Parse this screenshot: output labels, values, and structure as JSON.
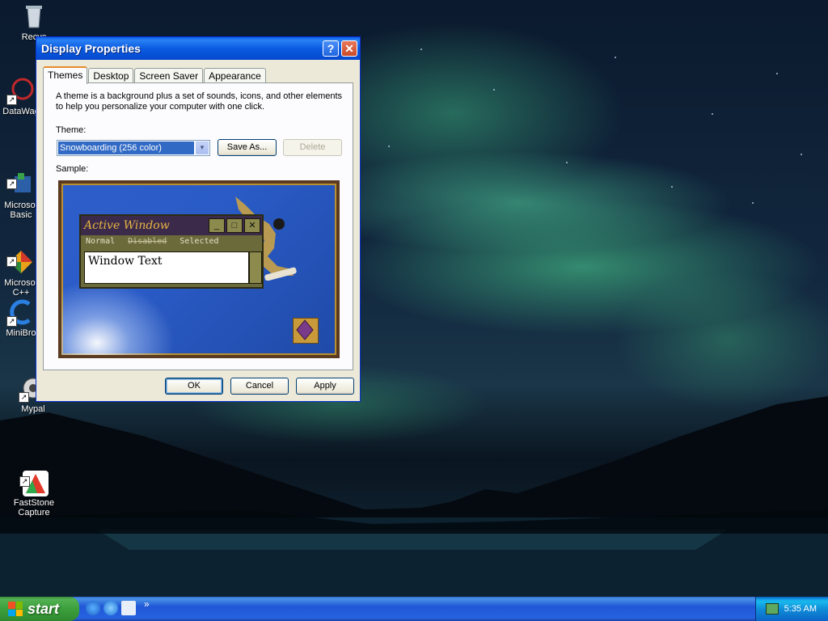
{
  "desktop": {
    "icons": [
      {
        "label": "Recyc",
        "icon": "recycle-bin-icon"
      },
      {
        "label": "DataWag",
        "icon": "datawag-icon"
      },
      {
        "label": "Microsof\nBasic",
        "icon": "ms-basic-icon"
      },
      {
        "label": "Microsof\nC++",
        "icon": "ms-cpp-icon"
      },
      {
        "label": "MiniBro",
        "icon": "minibrowser-icon"
      },
      {
        "label": "Mypal",
        "icon": "mypal-icon"
      },
      {
        "label": "FastStone\nCapture",
        "icon": "faststone-icon"
      }
    ]
  },
  "window": {
    "title": "Display Properties",
    "help_btn": "?",
    "close_btn": "✕",
    "tabs": [
      "Themes",
      "Desktop",
      "Screen Saver",
      "Appearance"
    ],
    "active_tab": "Themes",
    "description": "A theme is a background plus a set of sounds, icons, and other elements to help you personalize your computer with one click.",
    "theme_label": "Theme:",
    "theme_value": "Snowboarding (256 color)",
    "save_as": "Save As...",
    "delete": "Delete",
    "sample_label": "Sample:",
    "sample": {
      "active_window_title": "Active Window",
      "menu_normal": "Normal",
      "menu_disabled": "Disabled",
      "menu_selected": "Selected",
      "window_text": "Window Text"
    },
    "ok": "OK",
    "cancel": "Cancel",
    "apply": "Apply"
  },
  "taskbar": {
    "start_label": "start",
    "quick_launch_more": "»",
    "clock": "5:35 AM",
    "colors": {
      "start": "#3c9f3c",
      "bar": "#2157d7",
      "tray": "#0f8ed8"
    }
  }
}
